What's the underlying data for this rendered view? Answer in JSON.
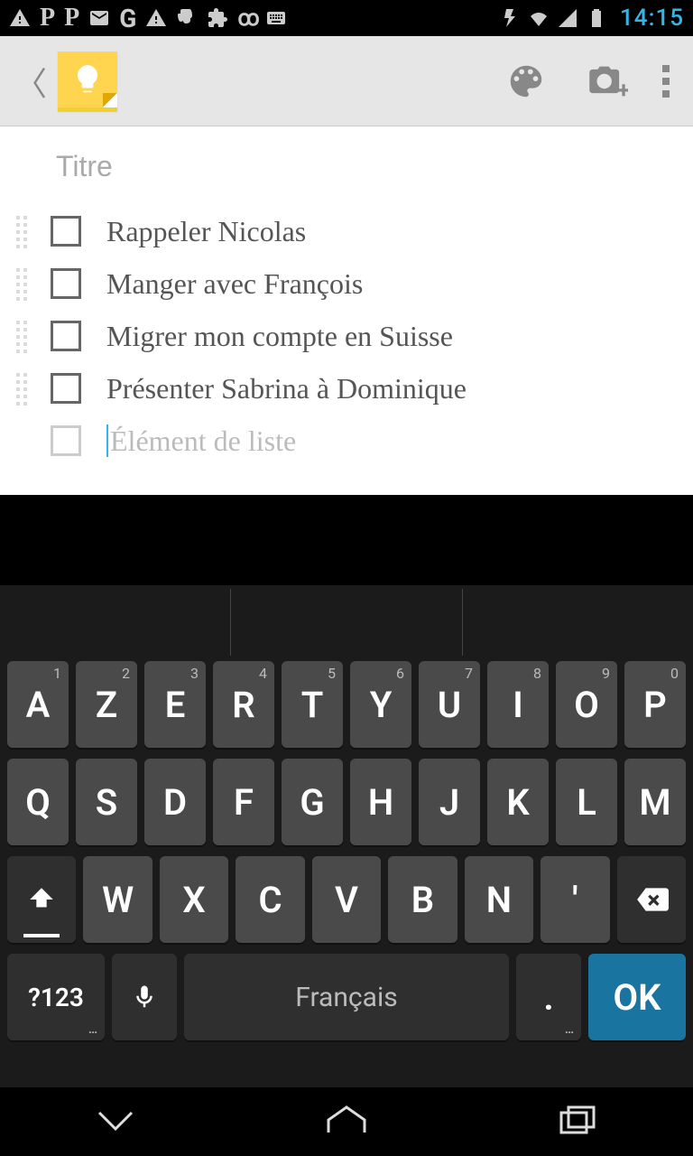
{
  "status_bar": {
    "time": "14:15"
  },
  "note": {
    "title_placeholder": "Titre",
    "items": [
      {
        "text": "Rappeler Nicolas"
      },
      {
        "text": "Manger avec François"
      },
      {
        "text": "Migrer mon compte en Suisse"
      },
      {
        "text": "Présenter Sabrina à Dominique"
      }
    ],
    "new_item_placeholder": "Élément de liste"
  },
  "keyboard": {
    "row1": [
      {
        "l": "A",
        "h": "1"
      },
      {
        "l": "Z",
        "h": "2"
      },
      {
        "l": "E",
        "h": "3"
      },
      {
        "l": "R",
        "h": "4"
      },
      {
        "l": "T",
        "h": "5"
      },
      {
        "l": "Y",
        "h": "6"
      },
      {
        "l": "U",
        "h": "7"
      },
      {
        "l": "I",
        "h": "8"
      },
      {
        "l": "O",
        "h": "9"
      },
      {
        "l": "P",
        "h": "0"
      }
    ],
    "row2": [
      "Q",
      "S",
      "D",
      "F",
      "G",
      "H",
      "J",
      "K",
      "L",
      "M"
    ],
    "row3": [
      "W",
      "X",
      "C",
      "V",
      "B",
      "N",
      "'"
    ],
    "sym": "?123",
    "space": "Français",
    "period": ".",
    "ok": "OK"
  }
}
